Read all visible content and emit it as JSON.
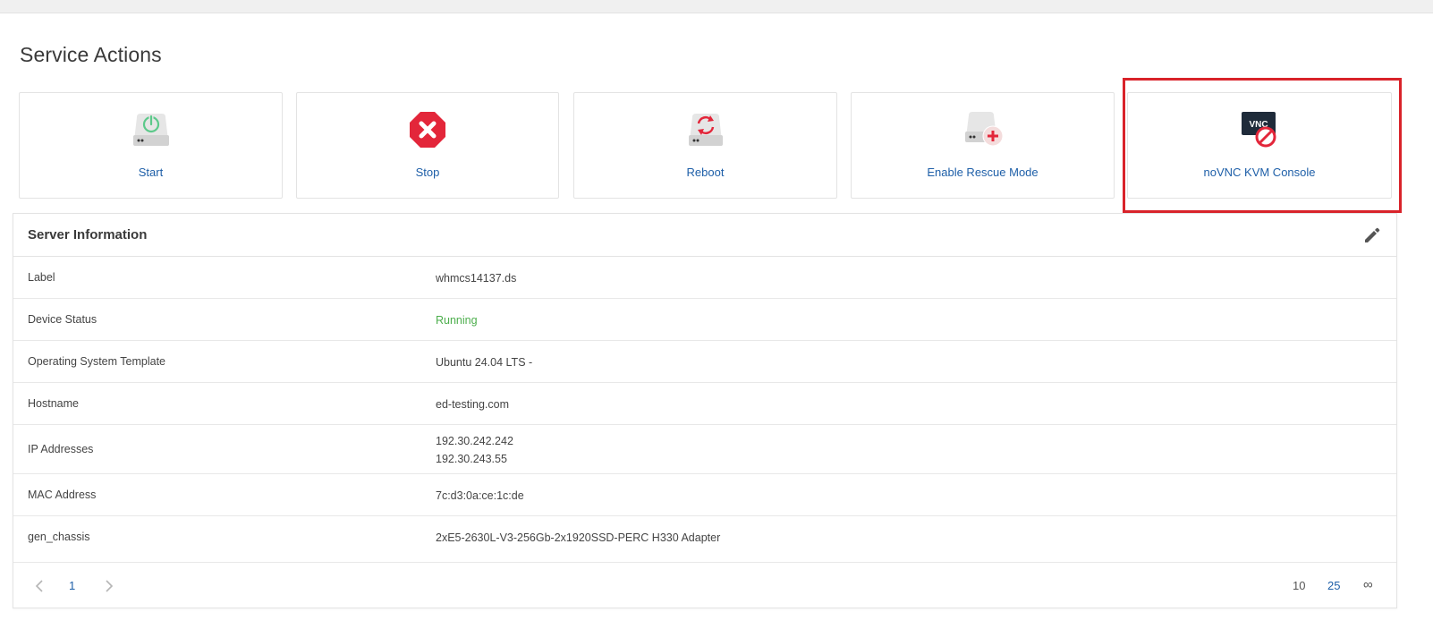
{
  "section_title": "Service Actions",
  "actions": [
    {
      "label": "Start",
      "icon": "server-power-icon"
    },
    {
      "label": "Stop",
      "icon": "stop-octagon-icon"
    },
    {
      "label": "Reboot",
      "icon": "server-reboot-icon"
    },
    {
      "label": "Enable Rescue Mode",
      "icon": "server-rescue-icon"
    },
    {
      "label": "noVNC KVM Console",
      "icon": "vnc-disabled-icon",
      "icon_text": "VNC"
    }
  ],
  "server_info": {
    "title": "Server Information",
    "rows": [
      {
        "key": "Label",
        "value": "whmcs14137.ds"
      },
      {
        "key": "Device Status",
        "value": "Running"
      },
      {
        "key": "Operating System Template",
        "value": "Ubuntu 24.04 LTS -"
      },
      {
        "key": "Hostname",
        "value": "ed-testing.com"
      },
      {
        "key": "IP Addresses",
        "values": [
          "192.30.242.242",
          "192.30.243.55"
        ]
      },
      {
        "key": "MAC Address",
        "value": "7c:d3:0a:ce:1c:de"
      },
      {
        "key": "gen_chassis",
        "value": "2xE5-2630L-V3-256Gb-2x1920SSD-PERC H330 Adapter"
      }
    ]
  },
  "pagination": {
    "current_page": "1",
    "page_sizes": [
      "10",
      "25",
      "∞"
    ]
  },
  "colors": {
    "link": "#1e5fa8",
    "running": "#4cae4c",
    "highlight": "#d9232a",
    "stop": "#e3263a"
  }
}
